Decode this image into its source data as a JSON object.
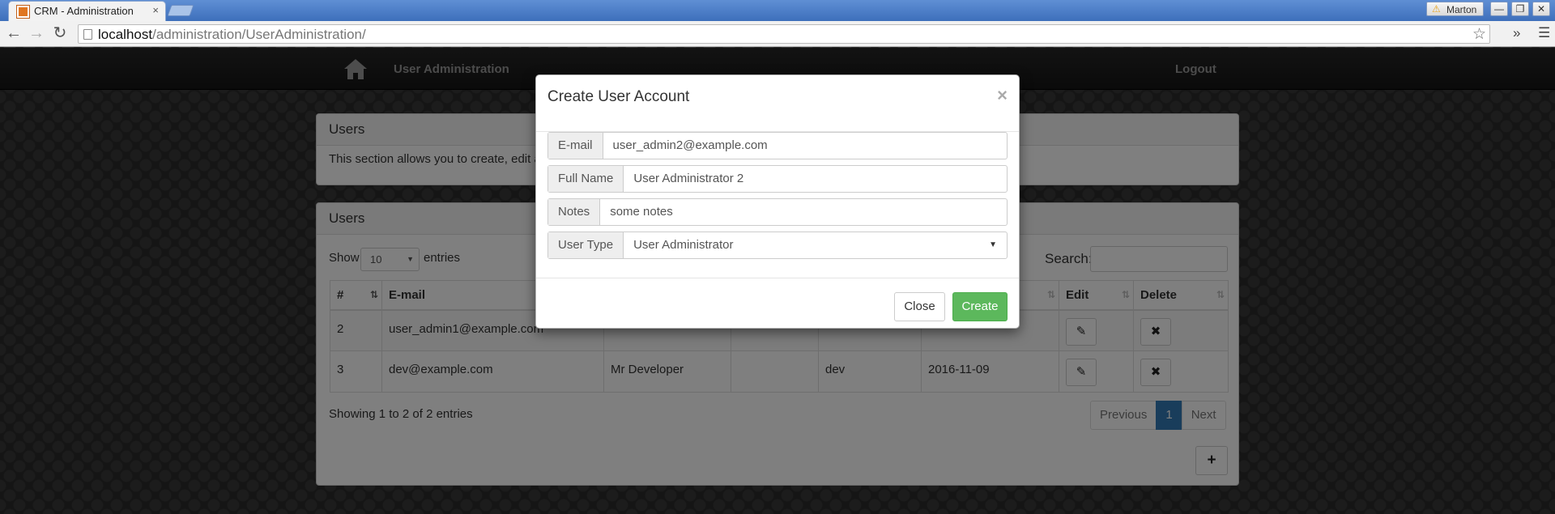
{
  "browser": {
    "tab_title": "CRM - Administration",
    "tab_close": "×",
    "url_host": "localhost",
    "url_path": "/administration/UserAdministration/",
    "profile_name": "Marton",
    "win_min": "—",
    "win_restore": "❐",
    "win_close": "✕",
    "extensions": "»",
    "menu": "☰"
  },
  "navbar": {
    "brand": "User Administration",
    "logout": "Logout"
  },
  "intro_panel": {
    "title": "Users",
    "text": "This section allows you to create, edit an"
  },
  "users_panel": {
    "title": "Users",
    "show_label": "Show",
    "entries_value": "10",
    "entries_label": "entries",
    "search_label": "Search:",
    "columns": [
      "#",
      "E-mail",
      "",
      "",
      "",
      "",
      "Edit",
      "Delete"
    ],
    "rows": [
      {
        "id": "2",
        "email": "user_admin1@example.com",
        "name": "",
        "notes": "",
        "type": "",
        "date": ""
      },
      {
        "id": "3",
        "email": "dev@example.com",
        "name": "Mr Developer",
        "notes": "",
        "type": "dev",
        "date": "2016-11-09"
      }
    ],
    "showing": "Showing 1 to 2 of 2 entries",
    "pager": {
      "previous": "Previous",
      "page": "1",
      "next": "Next"
    },
    "add_symbol": "+"
  },
  "modal": {
    "title": "Create User Account",
    "close_symbol": "×",
    "fields": {
      "email": {
        "label": "E-mail",
        "value": "user_admin2@example.com"
      },
      "full_name": {
        "label": "Full Name",
        "value": "User Administrator 2"
      },
      "notes": {
        "label": "Notes",
        "value": "some notes"
      },
      "user_type": {
        "label": "User Type",
        "value": "User Administrator"
      }
    },
    "close_button": "Close",
    "create_button": "Create"
  },
  "colors": {
    "primary": "#337ab7",
    "success": "#5cb85c",
    "navbar": "#1e1e1e"
  }
}
